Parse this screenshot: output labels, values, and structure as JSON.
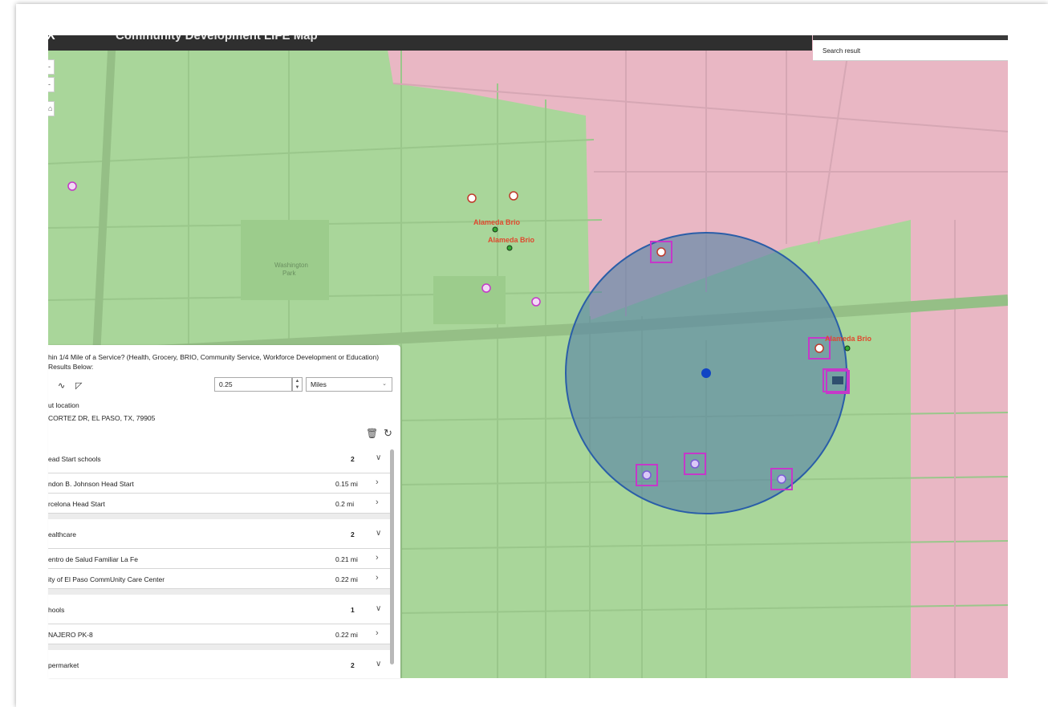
{
  "app": {
    "title": "Community Development LIFE Map",
    "search_result_label": "Search result"
  },
  "map": {
    "colors": {
      "green_zone": "#a9d69a",
      "pink_zone": "#e9b7c4",
      "buffer_fill": "#5a86a6",
      "buffer_stroke": "#2a5ea8",
      "highlight": "#c538c9",
      "brio_label": "#e0482e",
      "center_point": "#1144c4"
    },
    "labels": {
      "brio_1": "Alameda Brio",
      "brio_2": "Alameda Brio",
      "brio_3": "Alameda Brio"
    }
  },
  "panel": {
    "question": "hin 1/4 Mile of a Service? (Health, Grocery, BRIO, Community Service, Workforce Development or Education)",
    "results_hint": "Results Below:",
    "distance_value": "0.25",
    "distance_unit": "Miles",
    "input_location_title": "ut location",
    "input_location_value": "CORTEZ DR, EL PASO, TX, 79905",
    "groups": [
      {
        "name": "ead Start schools",
        "count": "2",
        "rows": [
          {
            "name": "ndon B. Johnson Head Start",
            "dist": "0.15 mi"
          },
          {
            "name": "rcelona Head Start",
            "dist": "0.2 mi"
          }
        ]
      },
      {
        "name": "ealthcare",
        "count": "2",
        "rows": [
          {
            "name": "entro de Salud Familiar La Fe",
            "dist": "0.21 mi"
          },
          {
            "name": "ity of El Paso CommUnity Care Center",
            "dist": "0.22 mi"
          }
        ]
      },
      {
        "name": "hools",
        "count": "1",
        "rows": [
          {
            "name": "NAJERO PK-8",
            "dist": "0.22 mi"
          }
        ]
      },
      {
        "name": "permarket",
        "count": "2",
        "rows": []
      }
    ]
  }
}
